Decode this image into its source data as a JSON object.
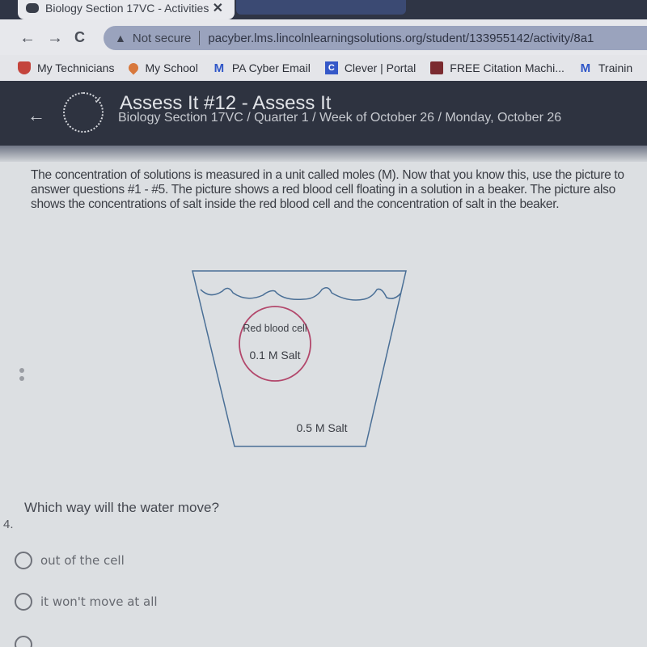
{
  "browser": {
    "tab_title": "Biology Section 17VC - Activities",
    "nav": {
      "back": "←",
      "forward": "→",
      "reload": "C"
    },
    "security_label": "Not secure",
    "url": "pacyber.lms.lincolnlearningsolutions.org/student/133955142/activity/8a1",
    "bookmarks": [
      {
        "label": "My Technicians",
        "icon": "shield-icon"
      },
      {
        "label": "My School",
        "icon": "location-pin-icon"
      },
      {
        "label": "PA Cyber Email",
        "icon": "gmail-icon"
      },
      {
        "label": "Clever | Portal",
        "icon": "clever-icon"
      },
      {
        "label": "FREE Citation Machi...",
        "icon": "citation-machine-icon"
      },
      {
        "label": "Trainin",
        "icon": "gmail-icon"
      }
    ]
  },
  "header": {
    "title": "Assess It #12 - Assess It",
    "breadcrumb": "Biology Section 17VC / Quarter 1 / Week of October 26 / Monday, October 26"
  },
  "intro_text": "The concentration of solutions is measured in a unit called moles (M).  Now that you know this, use the picture to answer questions #1 - #5.  The picture shows a red blood cell floating in a solution in a beaker.  The picture also shows the concentrations of salt inside the red blood cell and the concentration of salt in the beaker.",
  "diagram": {
    "cell_label": "Red blood cell",
    "cell_concentration": "0.1 M Salt",
    "beaker_concentration": "0.5 M Salt",
    "cell_color": "#b2476b",
    "beaker_color": "#4a6f96"
  },
  "question": {
    "number": "4.",
    "text": "Which way will the water move?",
    "options": [
      {
        "label": "out of the cell",
        "selected": false
      },
      {
        "label": "it won't move at all",
        "selected": false
      }
    ]
  }
}
